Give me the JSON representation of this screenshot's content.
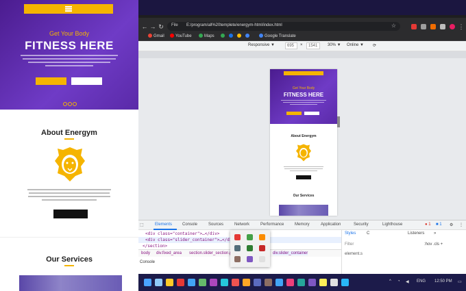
{
  "site": {
    "hero_subtitle": "Get Your Body",
    "hero_title": "FITNESS HERE",
    "about_title": "About Energym",
    "services_title": "Our Services"
  },
  "browser": {
    "url_info": "File",
    "url": "E:/program/all%20templete/energym-html/index.html",
    "bookmarks": [
      "Gmail",
      "YouTube",
      "Maps",
      "Google Translate"
    ]
  },
  "device_toolbar": {
    "mode": "Responsive ▼",
    "width": "695",
    "x": "×",
    "height": "1541",
    "zoom": "30% ▼",
    "network": "Online ▼"
  },
  "devtools": {
    "tabs": [
      "Elements",
      "Console",
      "Sources",
      "Network",
      "Performance",
      "Memory",
      "Application",
      "Security",
      "Lighthouse"
    ],
    "active_tab": "Elements",
    "code_lines": [
      "<div class=\"container\">…</div>",
      "<div class=\"slider_container\">…</div> == $0",
      "</section>"
    ],
    "breadcrumbs": [
      "body",
      "div.fixed_area",
      "section.slider_section.position-relative",
      "div.slider_container"
    ],
    "console_label": "Console",
    "styles_tabs": [
      "Styles",
      "C",
      "Listeners",
      "»"
    ],
    "filter_placeholder": "Filter",
    "hov_cls": ":hov .cls +",
    "element_style": "element.s",
    "badge_errors": "1",
    "badge_msgs": "1"
  },
  "taskbar": {
    "lang": "ENG",
    "time": "12:50 PM"
  },
  "colors": {
    "accent": "#f5b400",
    "hero_purple": "#5a2aa8",
    "devtools_blue": "#1a73e8"
  }
}
